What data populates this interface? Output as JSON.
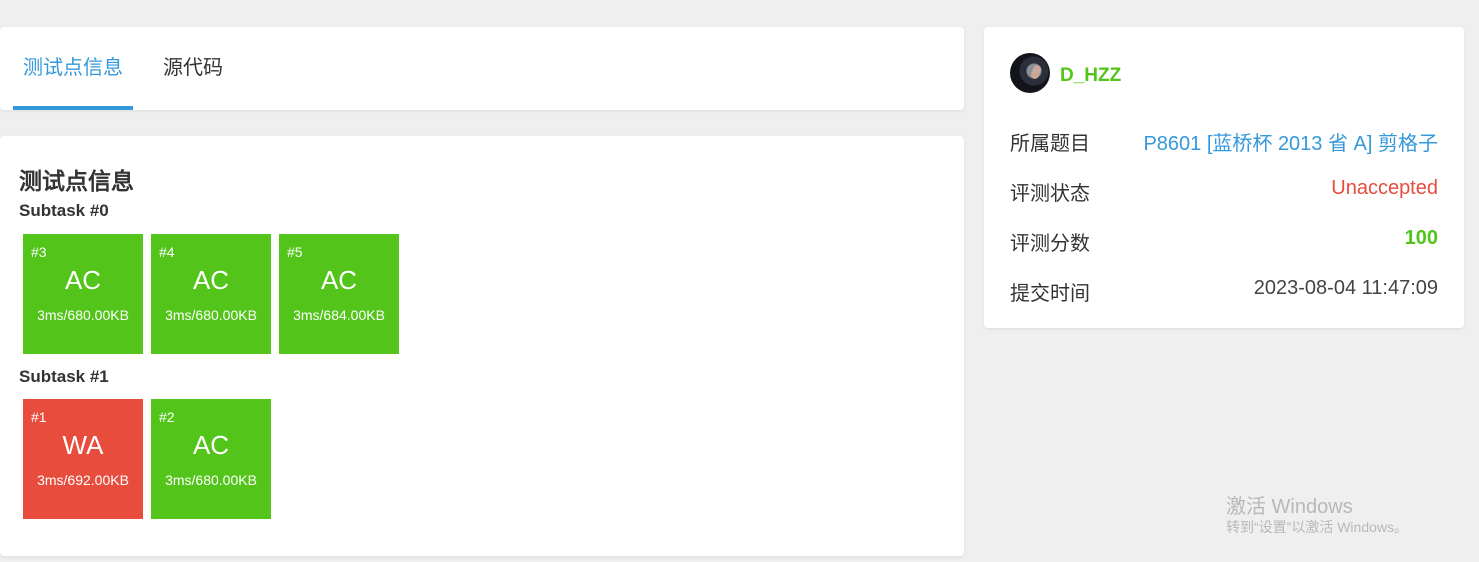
{
  "tabs": [
    {
      "label": "测试点信息",
      "active": true
    },
    {
      "label": "源代码",
      "active": false
    }
  ],
  "main": {
    "section_title": "测试点信息",
    "subtasks": [
      {
        "title": "Subtask #0",
        "cases": [
          {
            "id": "#3",
            "verdict": "AC",
            "result": "3ms/680.00KB"
          },
          {
            "id": "#4",
            "verdict": "AC",
            "result": "3ms/680.00KB"
          },
          {
            "id": "#5",
            "verdict": "AC",
            "result": "3ms/684.00KB"
          }
        ]
      },
      {
        "title": "Subtask #1",
        "cases": [
          {
            "id": "#1",
            "verdict": "WA",
            "result": "3ms/692.00KB"
          },
          {
            "id": "#2",
            "verdict": "AC",
            "result": "3ms/680.00KB"
          }
        ]
      }
    ]
  },
  "side": {
    "username": "D_HZZ",
    "rows": [
      {
        "label": "所属题目",
        "value": "P8601 [蓝桥杯 2013 省 A] 剪格子"
      },
      {
        "label": "评测状态",
        "value": "Unaccepted"
      },
      {
        "label": "评测分数",
        "value": "100"
      },
      {
        "label": "提交时间",
        "value": "2023-08-04 11:47:09"
      }
    ]
  },
  "watermark": {
    "line1": "激活 Windows",
    "line2": "转到“设置”以激活 Windows。"
  },
  "colors": {
    "accent": "#3498db",
    "ac": "#52c41a",
    "wa": "#e74c3c"
  }
}
